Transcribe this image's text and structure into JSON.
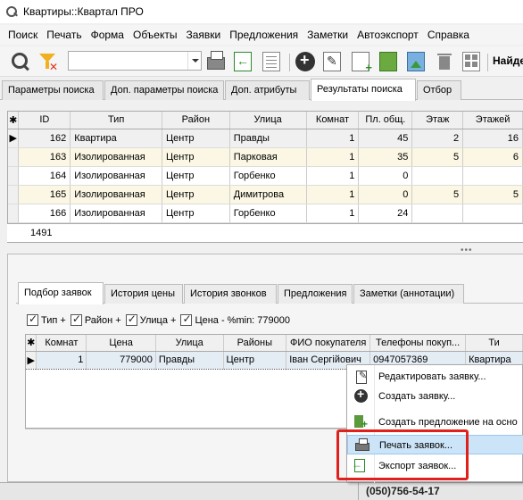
{
  "window": {
    "title": "Квартиры::Квартал ПРО"
  },
  "menu": [
    "Поиск",
    "Печать",
    "Форма",
    "Объекты",
    "Заявки",
    "Предложения",
    "Заметки",
    "Автоэкспорт",
    "Справка"
  ],
  "toolbar": {
    "search_value": "",
    "find_label": "Найде"
  },
  "top_tabs": [
    "Параметры поиска",
    "Доп. параметры поиска",
    "Доп. атрибуты",
    "Результаты поиска",
    "Отбор"
  ],
  "top_tab_active": "Результаты поиска",
  "results": {
    "columns": [
      "ID",
      "Тип",
      "Район",
      "Улица",
      "Комнат",
      "Пл. общ.",
      "Этаж",
      "Этажей"
    ],
    "rows": [
      [
        "162",
        "Квартира",
        "Центр",
        "Правды",
        "1",
        "45",
        "2",
        "16"
      ],
      [
        "163",
        "Изолированная",
        "Центр",
        "Парковая",
        "1",
        "35",
        "5",
        "6"
      ],
      [
        "164",
        "Изолированная",
        "Центр",
        "Горбенко",
        "1",
        "0",
        "",
        ""
      ],
      [
        "165",
        "Изолированная",
        "Центр",
        "Димитрова",
        "1",
        "0",
        "5",
        "5"
      ],
      [
        "166",
        "Изолированная",
        "Центр",
        "Горбенко",
        "1",
        "24",
        "",
        ""
      ]
    ],
    "count": "1491"
  },
  "lower_tabs": [
    "Подбор заявок",
    "История цены",
    "История звонков",
    "Предложения",
    "Заметки (аннотации)"
  ],
  "lower_tab_active": "Подбор заявок",
  "filters": [
    {
      "label": "Тип +",
      "checked": true
    },
    {
      "label": "Район +",
      "checked": true
    },
    {
      "label": "Улица +",
      "checked": true
    },
    {
      "label": "Цена - %min: 779000",
      "checked": true
    }
  ],
  "requests": {
    "columns": [
      "Комнат",
      "Цена",
      "Улица",
      "Районы",
      "ФИО покупателя",
      "Телефоны покуп...",
      "Ти"
    ],
    "rows": [
      [
        "1",
        "779000",
        "Правды",
        "Центр",
        "Іван Сергійович",
        "0947057369",
        "Квартира"
      ]
    ]
  },
  "context_menu": {
    "items": [
      {
        "label": "Редактировать заявку...",
        "icon": "edit-request-icon"
      },
      {
        "label": "Создать заявку...",
        "icon": "add-circle-icon"
      },
      {
        "label": "Создать предложение на осно",
        "icon": "building-add-icon"
      },
      {
        "label": "Печать заявок...",
        "icon": "printer-icon"
      },
      {
        "label": "Экспорт заявок...",
        "icon": "export-icon"
      }
    ],
    "highlighted": "Печать заявок..."
  },
  "status": {
    "phone": "(050)756-54-17"
  },
  "colors": {
    "highlight": "#cce4f7",
    "annotation_red": "#e0201c",
    "alt_row": "#fbf7e4"
  }
}
